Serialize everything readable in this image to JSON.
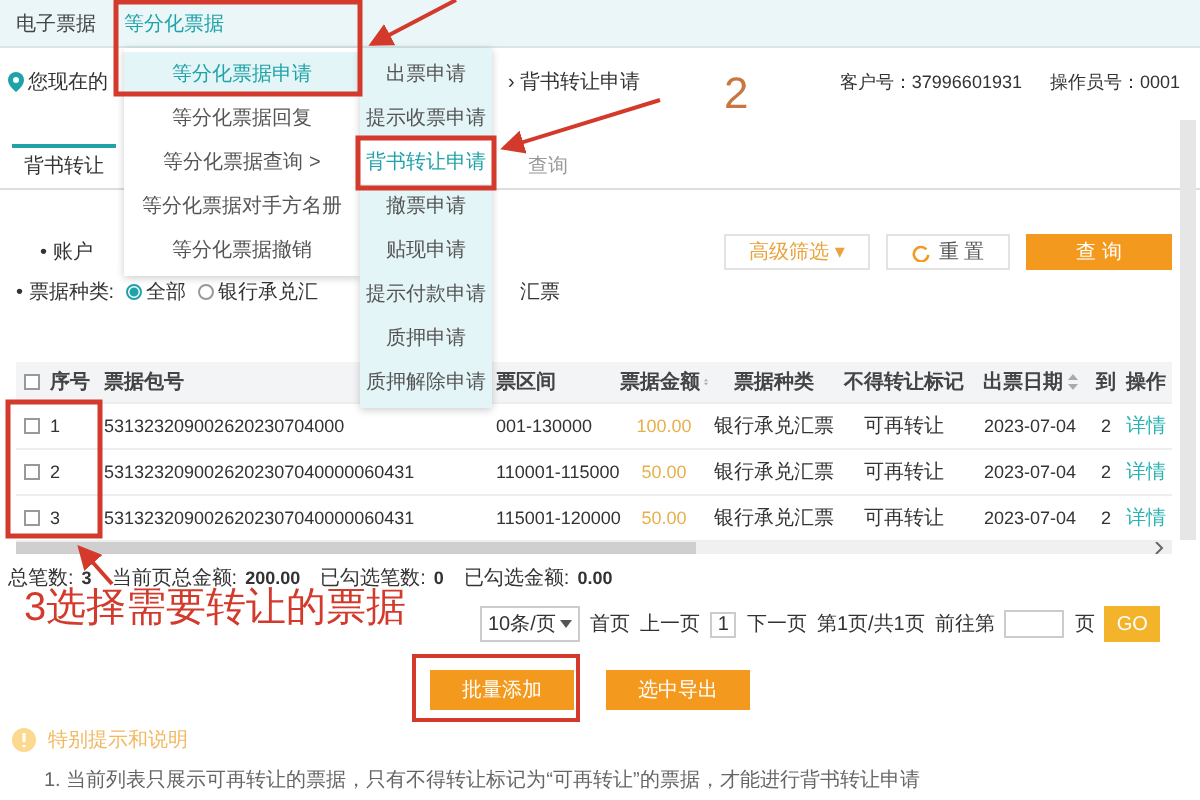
{
  "nav": {
    "items": [
      {
        "label": "电子票据",
        "selected": false
      },
      {
        "label": "等分化票据",
        "selected": true
      }
    ]
  },
  "menu": {
    "items": [
      {
        "label": "等分化票据申请",
        "selected": true
      },
      {
        "label": "等分化票据回复",
        "selected": false
      },
      {
        "label": "等分化票据查询",
        "selected": false,
        "arrow": ">"
      },
      {
        "label": "等分化票据对手方名册",
        "selected": false
      },
      {
        "label": "等分化票据撤销",
        "selected": false
      }
    ]
  },
  "submenu": {
    "items": [
      {
        "label": "出票申请",
        "selected": false
      },
      {
        "label": "提示收票申请",
        "selected": false
      },
      {
        "label": "背书转让申请",
        "selected": true
      },
      {
        "label": "撤票申请",
        "selected": false
      },
      {
        "label": "贴现申请",
        "selected": false
      },
      {
        "label": "提示付款申请",
        "selected": false
      },
      {
        "label": "质押申请",
        "selected": false
      },
      {
        "label": "质押解除申请",
        "selected": false
      }
    ]
  },
  "breadcrumb": {
    "prefix": "您现在的",
    "separator": "›",
    "current": "背书转让申请"
  },
  "account": [
    {
      "label": "客户号：",
      "value": "37996601931"
    },
    {
      "label": "操作员号：",
      "value": "0001"
    }
  ],
  "tabs": [
    {
      "label": "背书转让",
      "selected": true
    },
    {
      "label": "查询",
      "selected": false
    }
  ],
  "filters": {
    "account_label": "• 账户",
    "buttons": [
      {
        "kind": "dropdown",
        "label": "高级筛选",
        "caret": "▾"
      },
      {
        "kind": "reset",
        "label": "重 置"
      },
      {
        "kind": "primary",
        "label": "查 询"
      }
    ],
    "bill_type": {
      "label": "• 票据种类:",
      "options": [
        {
          "kind": "radio",
          "label": "全部",
          "selected": true
        },
        {
          "kind": "radio",
          "label": "银行承兑汇",
          "selected": false
        },
        {
          "kind": "text",
          "label": "汇票"
        }
      ]
    }
  },
  "table": {
    "select_all": {
      "checked": false
    },
    "columns": [
      {
        "label": "序号",
        "sortable": false
      },
      {
        "label": "票据包号",
        "sortable": false
      },
      {
        "label": "票区间",
        "sortable": false
      },
      {
        "label": "票据金额",
        "sortable": true
      },
      {
        "label": "票据种类",
        "sortable": false
      },
      {
        "label": "不得转让标记",
        "sortable": false
      },
      {
        "label": "出票日期",
        "sortable": true
      },
      {
        "label": "到",
        "sortable": false
      },
      {
        "label": "操作",
        "sortable": false
      }
    ],
    "rows": [
      {
        "checked": false,
        "cells": [
          "1",
          "531323209002620230704000",
          "001-130000",
          "100.00",
          "银行承兑汇票",
          "可再转让",
          "2023-07-04",
          "2",
          "详情"
        ]
      },
      {
        "checked": false,
        "cells": [
          "2",
          "5313232090026202307040000060431",
          "110001-115000",
          "50.00",
          "银行承兑汇票",
          "可再转让",
          "2023-07-04",
          "2",
          "详情"
        ]
      },
      {
        "checked": false,
        "cells": [
          "3",
          "5313232090026202307040000060431",
          "115001-120000",
          "50.00",
          "银行承兑汇票",
          "可再转让",
          "2023-07-04",
          "2",
          "详情"
        ]
      }
    ]
  },
  "totals": [
    {
      "label": "总笔数:",
      "value": "3"
    },
    {
      "label": "当前页总金额:",
      "value": "200.00"
    },
    {
      "label": "已勾选笔数:",
      "value": "0"
    },
    {
      "label": "已勾选金额:",
      "value": "0.00"
    }
  ],
  "pagination": {
    "page_size": "10条/页",
    "first": "首页",
    "prev": "上一页",
    "current": "1",
    "next": "下一页",
    "info": "第1页/共1页",
    "goto_label": "前往第",
    "goto_suffix": "页",
    "go": "GO"
  },
  "actions": [
    "批量添加",
    "选中导出"
  ],
  "notice": {
    "title": "特别提示和说明",
    "lines": [
      "1. 当前列表只展示可再转让的票据，只有不得转让标记为“可再转让”的票据，才能进行背书转让申请"
    ]
  },
  "annotations": [
    {
      "kind": "step",
      "text": "2"
    },
    {
      "kind": "caption",
      "text": "3选择需要转让的票据"
    }
  ]
}
